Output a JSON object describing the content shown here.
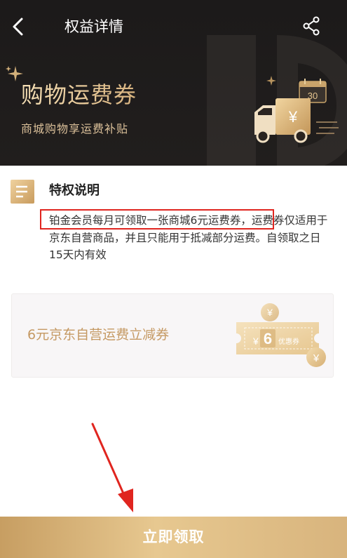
{
  "nav": {
    "title": "权益详情",
    "back_icon": "chevron-left-icon",
    "share_icon": "share-icon"
  },
  "banner": {
    "title": "购物运费券",
    "subtitle": "商城购物享运费补贴",
    "calendar_number": "30",
    "truck_symbol": "¥"
  },
  "privilege": {
    "title": "特权说明",
    "description_highlighted": "铂金会员每月可领取一张商城6元运费券",
    "description_rest": "，运费券仅适用于京东自营商品，并且只能用于抵减部分运费。自领取之日15天内有效"
  },
  "coupon": {
    "text": "6元京东自营运费立减券",
    "amount": "6",
    "currency": "¥",
    "label": "优惠券"
  },
  "action": {
    "claim_label": "立即领取"
  },
  "colors": {
    "header_bg": "#1f1c1c",
    "gold": "#c59963",
    "highlight_border": "#e0251f",
    "annotation_arrow": "#e0251f"
  }
}
